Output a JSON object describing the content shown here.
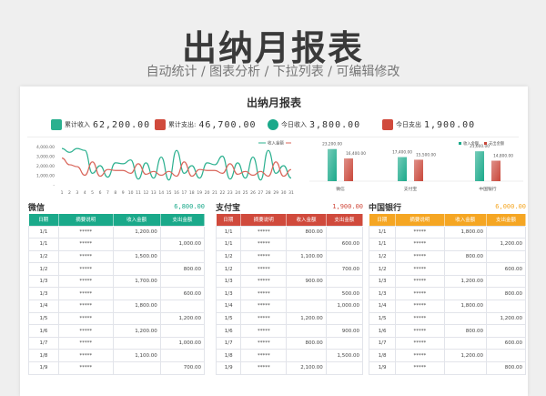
{
  "title": "出纳月报表",
  "subtitle": "自动统计 / 图表分析 / 下拉列表 / 可编辑修改",
  "report": {
    "title": "出纳月报表",
    "kpis": [
      {
        "label": "累计收入",
        "value": "62,200.00",
        "icon": "database-icon",
        "color": "#2bb08f"
      },
      {
        "label": "累计支出:",
        "value": "46,700.00",
        "icon": "layers-icon",
        "color": "#d04a3c"
      },
      {
        "label": "今日收入",
        "value": "3,800.00",
        "icon": "check-circle-icon",
        "color": "#1aa98a"
      },
      {
        "label": "今日支出",
        "value": "1,900.00",
        "icon": "grid-icon",
        "color": "#d04a3c"
      }
    ]
  },
  "chart_data": [
    {
      "type": "line",
      "legend": [
        "收入金额",
        ""
      ],
      "legend_position": "top-right",
      "ylim": [
        0,
        4000
      ],
      "yticks": [
        "4,000.00",
        "3,000.00",
        "2,000.00",
        "1,000.00",
        "-"
      ],
      "x": [
        1,
        2,
        3,
        4,
        5,
        6,
        7,
        8,
        9,
        10,
        11,
        12,
        13,
        14,
        15,
        16,
        17,
        18,
        19,
        20,
        21,
        22,
        23,
        24,
        25,
        26,
        27,
        28,
        29,
        30,
        31
      ],
      "series": [
        {
          "name": "收入金额",
          "color": "#2bb08f",
          "values": [
            3800,
            3400,
            3800,
            3600,
            1200,
            2000,
            800,
            2300,
            2200,
            2600,
            600,
            2300,
            700,
            2900,
            500,
            3600,
            1200,
            2000,
            700,
            2300,
            2100,
            3000,
            600,
            2300,
            700,
            2900,
            500,
            3600,
            1200,
            2000,
            700
          ]
        },
        {
          "color": "#d9655a",
          "values": [
            2800,
            2100,
            1900,
            1000,
            2400,
            900,
            1600,
            1500,
            1500,
            1200,
            2200,
            1100,
            1400,
            1000,
            1400,
            900,
            2400,
            900,
            1600,
            1500,
            1500,
            1200,
            2200,
            1100,
            1400,
            1000,
            1400,
            900,
            2400,
            900,
            1600
          ]
        }
      ]
    },
    {
      "type": "bar",
      "categories": [
        "微信",
        "支付宝",
        "中国银行"
      ],
      "legend": [
        "收入金额",
        "支出金额"
      ],
      "legend_position": "top-right",
      "ylim": [
        0,
        25000
      ],
      "series": [
        {
          "name": "收入金额",
          "color": "#1aa98a",
          "values": [
            23200,
            17400,
            21600
          ],
          "labels": [
            "23,200.00",
            "17,400.00",
            "21,600.00"
          ]
        },
        {
          "name": "支出金额",
          "color": "#c9473a",
          "values": [
            16400,
            15500,
            14800
          ],
          "labels": [
            "16,400.00",
            "15,500.00",
            "14,800.00"
          ]
        }
      ]
    }
  ],
  "columns": [
    "日期",
    "摘要说明",
    "收入金额",
    "支出金额"
  ],
  "panels": [
    {
      "name": "微信",
      "total": "6,800.00",
      "color": "#1aa98a",
      "rows": [
        [
          "1/1",
          "*****",
          "1,200.00",
          ""
        ],
        [
          "1/1",
          "*****",
          "",
          "1,000.00"
        ],
        [
          "1/2",
          "*****",
          "1,500.00",
          ""
        ],
        [
          "1/2",
          "*****",
          "",
          "800.00"
        ],
        [
          "1/3",
          "*****",
          "1,700.00",
          ""
        ],
        [
          "1/3",
          "*****",
          "",
          "600.00"
        ],
        [
          "1/4",
          "*****",
          "1,800.00",
          ""
        ],
        [
          "1/5",
          "*****",
          "",
          "1,200.00"
        ],
        [
          "1/6",
          "*****",
          "1,200.00",
          ""
        ],
        [
          "1/7",
          "*****",
          "",
          "1,000.00"
        ],
        [
          "1/8",
          "*****",
          "1,100.00",
          ""
        ],
        [
          "1/9",
          "*****",
          "",
          "700.00"
        ]
      ]
    },
    {
      "name": "支付宝",
      "total": "1,900.00",
      "color": "#d04a3c",
      "rows": [
        [
          "1/1",
          "*****",
          "800.00",
          ""
        ],
        [
          "1/1",
          "*****",
          "",
          "600.00"
        ],
        [
          "1/2",
          "*****",
          "1,100.00",
          ""
        ],
        [
          "1/2",
          "*****",
          "",
          "700.00"
        ],
        [
          "1/3",
          "*****",
          "900.00",
          ""
        ],
        [
          "1/3",
          "*****",
          "",
          "500.00"
        ],
        [
          "1/4",
          "*****",
          "",
          "1,000.00"
        ],
        [
          "1/5",
          "*****",
          "1,200.00",
          ""
        ],
        [
          "1/6",
          "*****",
          "",
          "900.00"
        ],
        [
          "1/7",
          "*****",
          "800.00",
          ""
        ],
        [
          "1/8",
          "*****",
          "",
          "1,500.00"
        ],
        [
          "1/9",
          "*****",
          "2,100.00",
          ""
        ]
      ]
    },
    {
      "name": "中国银行",
      "total": "6,000.00",
      "color": "#f5a623",
      "rows": [
        [
          "1/1",
          "*****",
          "1,800.00",
          ""
        ],
        [
          "1/1",
          "*****",
          "",
          "1,200.00"
        ],
        [
          "1/2",
          "*****",
          "800.00",
          ""
        ],
        [
          "1/2",
          "*****",
          "",
          "600.00"
        ],
        [
          "1/3",
          "*****",
          "1,200.00",
          ""
        ],
        [
          "1/3",
          "*****",
          "",
          "800.00"
        ],
        [
          "1/4",
          "*****",
          "1,800.00",
          ""
        ],
        [
          "1/5",
          "*****",
          "",
          "1,200.00"
        ],
        [
          "1/6",
          "*****",
          "800.00",
          ""
        ],
        [
          "1/7",
          "*****",
          "",
          "600.00"
        ],
        [
          "1/8",
          "*****",
          "1,200.00",
          ""
        ],
        [
          "1/9",
          "*****",
          "",
          "800.00"
        ]
      ]
    }
  ]
}
